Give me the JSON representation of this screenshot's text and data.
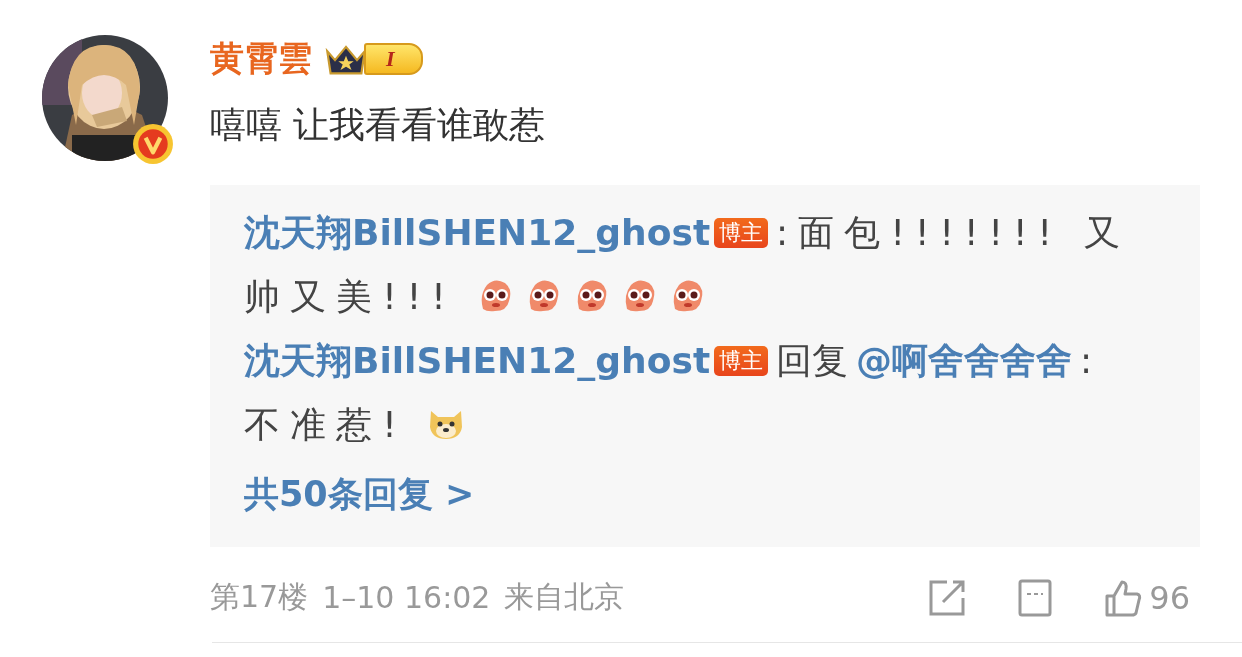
{
  "comment": {
    "author": "黄霄雲",
    "level_badge": "I",
    "verified": true,
    "text": "嘻嘻 让我看看谁敢惹"
  },
  "replies": [
    {
      "author": "沈天翔BillSHEN12_ghost",
      "author_badge": "博主",
      "text_lines": [
        ":面包!!!!!!! 又",
        "帅又美!!!"
      ],
      "emojis": [
        {
          "kind": "blob"
        },
        {
          "kind": "blob"
        },
        {
          "kind": "blob"
        },
        {
          "kind": "blob"
        },
        {
          "kind": "blob"
        }
      ]
    },
    {
      "author": "沈天翔BillSHEN12_ghost",
      "author_badge": "博主",
      "reply_prefix": "回复",
      "mention": "@啊舍舍舍舍",
      "text_lines": [
        ":",
        "不准惹!"
      ],
      "emojis": [
        {
          "kind": "dog"
        }
      ]
    }
  ],
  "more_replies": "共50条回复 >",
  "footer": {
    "floor": "第17楼",
    "time": "1–10 16:02",
    "location": "来自北京",
    "like_count": "96"
  }
}
